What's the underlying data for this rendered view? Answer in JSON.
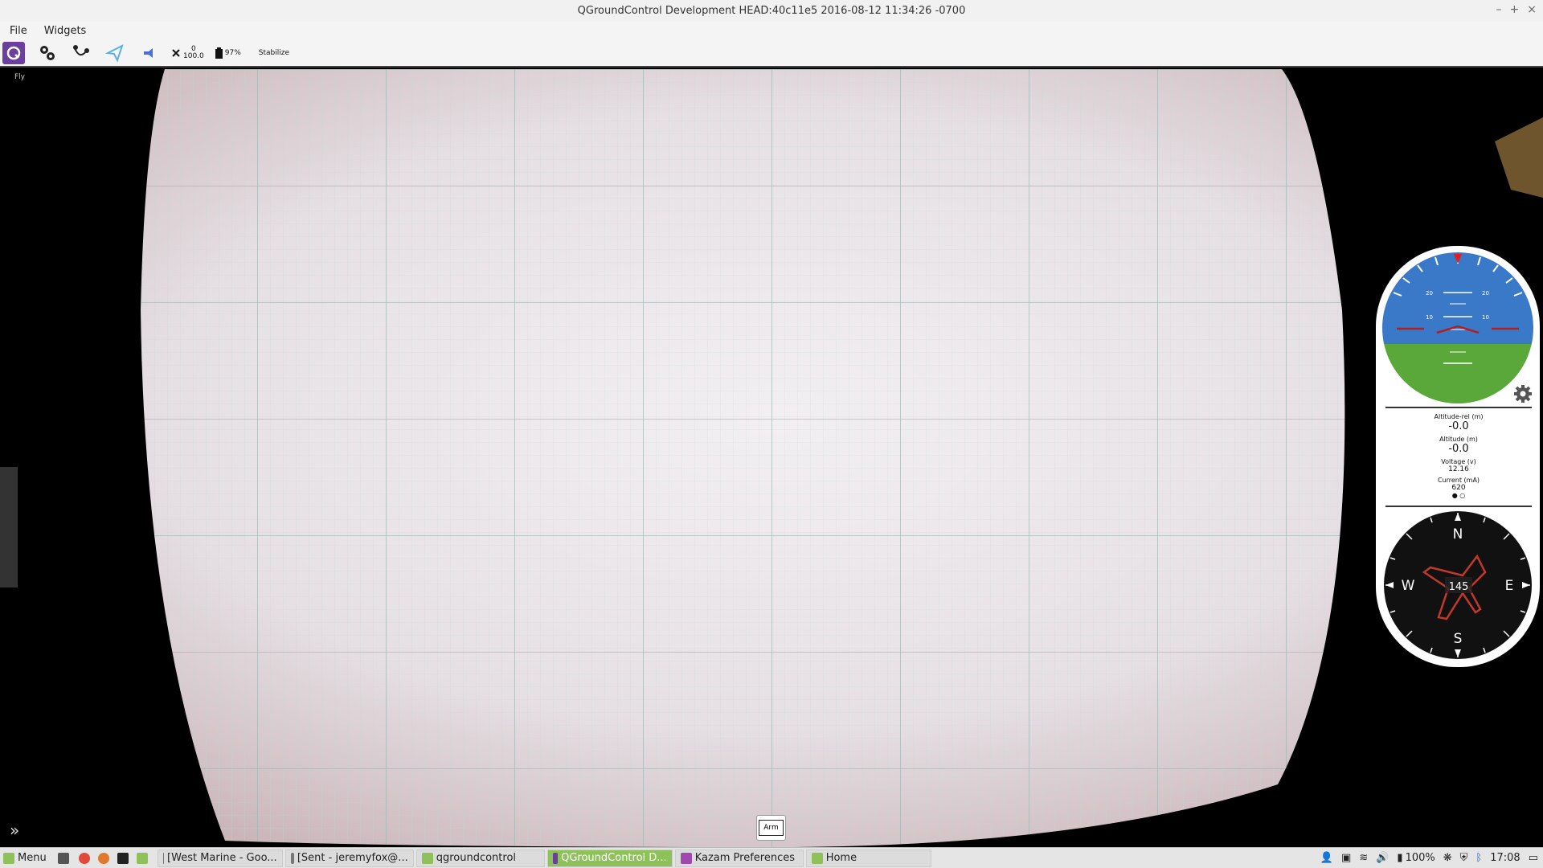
{
  "window": {
    "title": "QGroundControl Development HEAD:40c11e5 2016-08-12 11:34:26 -0700",
    "controls": [
      "–",
      "+",
      "×"
    ]
  },
  "menubar": {
    "file": "File",
    "widgets": "Widgets"
  },
  "toolbar": {
    "rc_rssi_top": "0",
    "rc_rssi_bottom": "100.0",
    "battery": "97%",
    "flight_mode": "Stabilize",
    "fly_label": "Fly"
  },
  "attitude": {
    "pitch_labels_upper": [
      "20",
      "20"
    ],
    "pitch_labels_mid": [
      "10",
      "10"
    ]
  },
  "values": {
    "alt_rel_label": "Altitude-rel (m)",
    "alt_rel": "-0.0",
    "alt_label": "Altitude (m)",
    "alt": "-0.0",
    "voltage_label": "Voltage (v)",
    "voltage": "12.16",
    "current_label": "Current (mA)",
    "current": "620"
  },
  "compass": {
    "heading": "145",
    "n": "N",
    "s": "S",
    "e": "E",
    "w": "W"
  },
  "arm": {
    "label": "Arm"
  },
  "taskbar": {
    "menu": "Menu",
    "items": [
      "[West Marine - Goo...",
      "[Sent - jeremyfox@...",
      "qgroundcontrol",
      "QGroundControl D...",
      "Kazam Preferences",
      "Home"
    ],
    "battery": "100%",
    "clock": "17:08"
  },
  "colors": {
    "accent": "#6a3fa0",
    "sky": "#3a78c8",
    "ground": "#5aa83a",
    "taskbar_active": "#8fc15a"
  }
}
